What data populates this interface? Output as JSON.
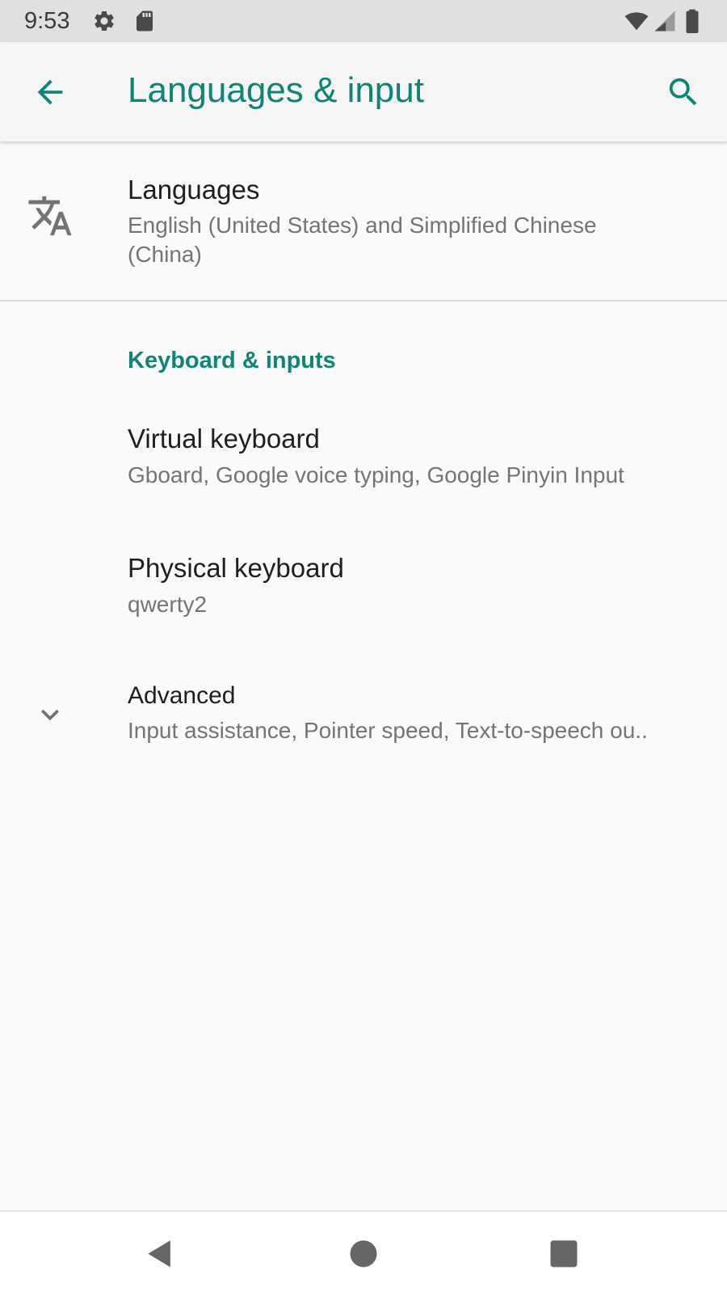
{
  "status_bar": {
    "time": "9:53",
    "icons": [
      "settings-icon",
      "sd-card-icon",
      "wifi-icon",
      "cell-signal-icon",
      "battery-icon"
    ]
  },
  "app_bar": {
    "title": "Languages & input",
    "back_icon": "arrow-back-icon",
    "search_icon": "search-icon"
  },
  "languages": {
    "title": "Languages",
    "summary": "English (United States) and Simplified Chinese (China)",
    "icon": "translate-icon"
  },
  "keyboard_section": {
    "header": "Keyboard & inputs",
    "items": [
      {
        "title": "Virtual keyboard",
        "summary": "Gboard, Google voice typing, Google Pinyin Input"
      },
      {
        "title": "Physical keyboard",
        "summary": "qwerty2"
      }
    ]
  },
  "advanced": {
    "title": "Advanced",
    "summary": "Input assistance, Pointer speed, Text-to-speech ou..",
    "icon": "chevron-down-icon"
  },
  "nav_bar": {
    "icons": [
      "back-triangle-icon",
      "home-circle-icon",
      "recents-square-icon"
    ]
  },
  "colors": {
    "accent": "#0f8577",
    "background": "#fafafa",
    "app_bar": "#f5f5f5",
    "status_bar": "#e0e0e0"
  }
}
